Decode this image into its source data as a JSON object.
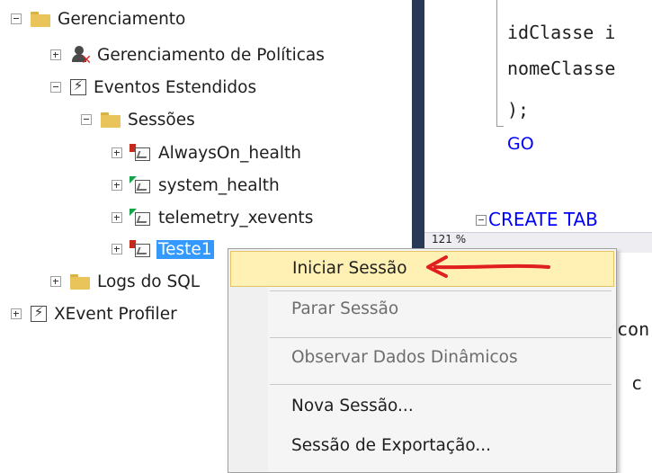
{
  "tree": {
    "management": "Gerenciamento",
    "policy_management": "Gerenciamento de Políticas",
    "extended_events": "Eventos Estendidos",
    "sessions": "Sessões",
    "session_items": [
      "AlwaysOn_health",
      "system_health",
      "telemetry_xevents",
      "Teste1"
    ],
    "sql_logs": "Logs do SQL",
    "xevent_profiler": "XEvent Profiler"
  },
  "editor": {
    "lines": [
      "idClasse i",
      "nomeClasse",
      ");",
      "GO",
      "CREATE TAB"
    ],
    "zoom": "121 %",
    "result_fragments": [
      "con",
      "c"
    ]
  },
  "context_menu": {
    "items": [
      {
        "label": "Iniciar Sessão",
        "state": "highlighted"
      },
      {
        "label": "Parar Sessão",
        "state": "disabled"
      },
      {
        "label": "Observar Dados Dinâmicos",
        "state": "disabled"
      },
      {
        "label": "Nova Sessão...",
        "state": "enabled"
      },
      {
        "label": "Sessão de Exportação...",
        "state": "enabled"
      }
    ]
  },
  "colors": {
    "selection": "#3399ff",
    "splitter": "#293955",
    "menu_highlight": "#fff0b3",
    "annotation_arrow": "#e02020",
    "keyword": "#0000ff"
  }
}
